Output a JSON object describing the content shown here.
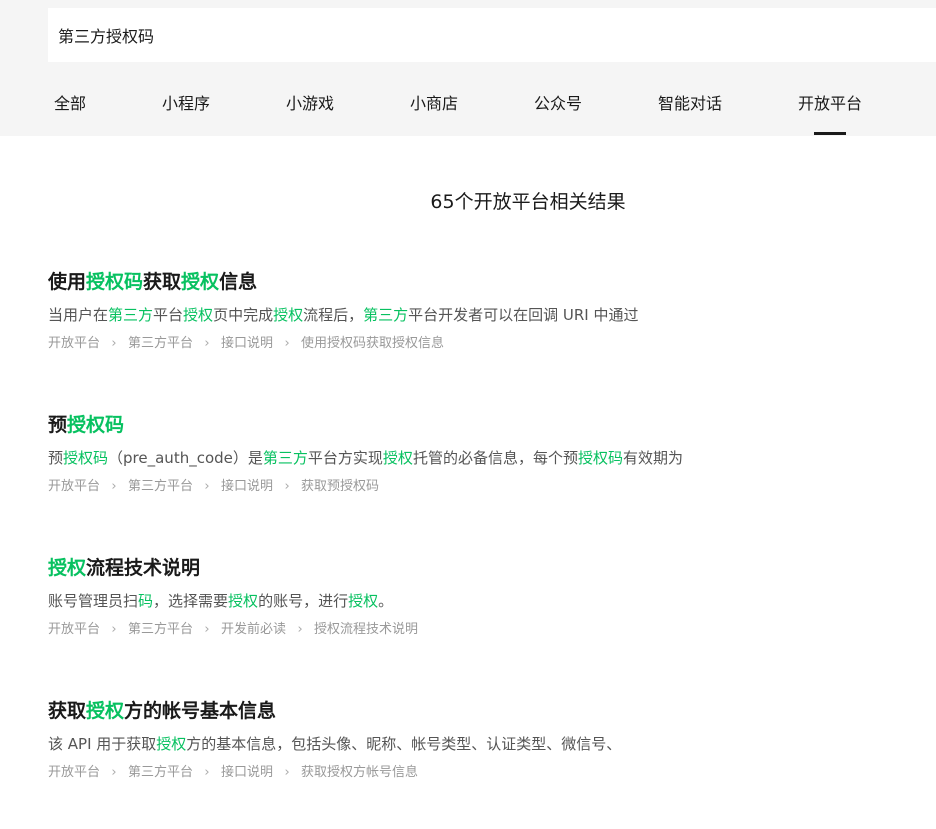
{
  "search": {
    "value": "第三方授权码"
  },
  "tabs": [
    {
      "label": "全部"
    },
    {
      "label": "小程序"
    },
    {
      "label": "小游戏"
    },
    {
      "label": "小商店"
    },
    {
      "label": "公众号"
    },
    {
      "label": "智能对话"
    },
    {
      "label": "开放平台",
      "active": true
    }
  ],
  "result_count": "65个开放平台相关结果",
  "separator_glyph": "›",
  "highlight_color": "#07c160",
  "results": [
    {
      "title": [
        {
          "t": "使用"
        },
        {
          "t": "授权码",
          "h": true
        },
        {
          "t": "获取"
        },
        {
          "t": "授权",
          "h": true
        },
        {
          "t": "信息"
        }
      ],
      "snippet": [
        {
          "t": "当用户在"
        },
        {
          "t": "第三方",
          "h": true
        },
        {
          "t": "平台"
        },
        {
          "t": "授权",
          "h": true
        },
        {
          "t": "页中完成"
        },
        {
          "t": "授权",
          "h": true
        },
        {
          "t": "流程后，"
        },
        {
          "t": "第三方",
          "h": true
        },
        {
          "t": "平台开发者可以在回调 URI 中通过"
        }
      ],
      "breadcrumb": [
        "开放平台",
        "第三方平台",
        "接口说明",
        "使用授权码获取授权信息"
      ]
    },
    {
      "title": [
        {
          "t": "预"
        },
        {
          "t": "授权码",
          "h": true
        }
      ],
      "snippet": [
        {
          "t": "预"
        },
        {
          "t": "授权码",
          "h": true
        },
        {
          "t": "（pre_auth_code）是"
        },
        {
          "t": "第三方",
          "h": true
        },
        {
          "t": "平台方实现"
        },
        {
          "t": "授权",
          "h": true
        },
        {
          "t": "托管的必备信息，每个预"
        },
        {
          "t": "授权码",
          "h": true
        },
        {
          "t": "有效期为"
        }
      ],
      "breadcrumb": [
        "开放平台",
        "第三方平台",
        "接口说明",
        "获取预授权码"
      ]
    },
    {
      "title": [
        {
          "t": "授权",
          "h": true
        },
        {
          "t": "流程技术说明"
        }
      ],
      "snippet": [
        {
          "t": "账号管理员扫"
        },
        {
          "t": "码",
          "h": true
        },
        {
          "t": "，选择需要"
        },
        {
          "t": "授权",
          "h": true
        },
        {
          "t": "的账号，进行"
        },
        {
          "t": "授权",
          "h": true
        },
        {
          "t": "。"
        }
      ],
      "breadcrumb": [
        "开放平台",
        "第三方平台",
        "开发前必读",
        "授权流程技术说明"
      ]
    },
    {
      "title": [
        {
          "t": "获取"
        },
        {
          "t": "授权",
          "h": true
        },
        {
          "t": "方的帐号基本信息"
        }
      ],
      "snippet": [
        {
          "t": "该 API 用于获取"
        },
        {
          "t": "授权",
          "h": true
        },
        {
          "t": "方的基本信息，包括头像、昵称、帐号类型、认证类型、微信号、"
        }
      ],
      "breadcrumb": [
        "开放平台",
        "第三方平台",
        "接口说明",
        "获取授权方帐号信息"
      ]
    }
  ]
}
